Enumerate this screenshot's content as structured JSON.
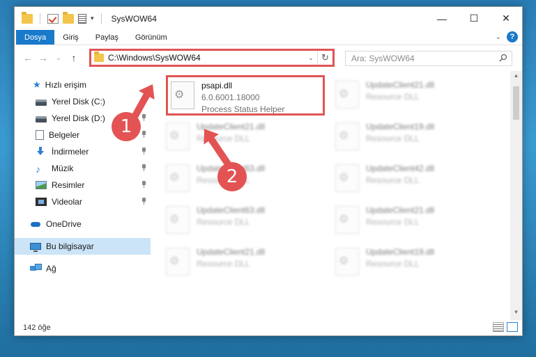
{
  "window": {
    "title": "SysWOW64"
  },
  "ribbon": {
    "tabs": [
      "Dosya",
      "Giriş",
      "Paylaş",
      "Görünüm"
    ]
  },
  "address": {
    "path": "C:\\Windows\\SysWOW64"
  },
  "search": {
    "placeholder": "Ara: SysWOW64"
  },
  "nav": {
    "quick_access": "Hızlı erişim",
    "items": [
      "Yerel Disk (C:)",
      "Yerel Disk (D:)",
      "Belgeler",
      "İndirmeler",
      "Müzik",
      "Resimler",
      "Videolar"
    ],
    "onedrive": "OneDrive",
    "this_pc": "Bu bilgisayar",
    "network": "Ağ"
  },
  "files": {
    "selected": {
      "name": "psapi.dll",
      "version": "6.0.6001.18000",
      "description": "Process Status Helper"
    },
    "blurred": [
      {
        "name": "UpdateClient21.dll",
        "sub": "Resource DLL"
      },
      {
        "name": "UpdateClient21.dll",
        "sub": "Resource DLL"
      },
      {
        "name": "UpdateClient19.dll",
        "sub": "Resource DLL"
      },
      {
        "name": "UpdateClient63.dll",
        "sub": "Resource DLL"
      },
      {
        "name": "UpdateClient42.dll",
        "sub": "Resource DLL"
      },
      {
        "name": "UpdateClient63.dll",
        "sub": "Resource DLL"
      },
      {
        "name": "UpdateClient21.dll",
        "sub": "Resource DLL"
      },
      {
        "name": "UpdateClient21.dll",
        "sub": "Resource DLL"
      },
      {
        "name": "UpdateClient19.dll",
        "sub": "Resource DLL"
      }
    ]
  },
  "status": {
    "count": "142 öğe"
  },
  "annotations": {
    "step1": "1",
    "step2": "2",
    "color": "#e35353"
  }
}
